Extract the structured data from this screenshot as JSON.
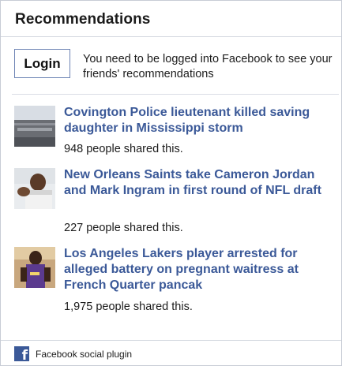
{
  "header": {
    "title": "Recommendations"
  },
  "login": {
    "button_label": "Login",
    "message": "You need to be logged into Facebook to see your friends' recommendations"
  },
  "items": [
    {
      "title": "Covington Police lieutenant killed saving daughter in Mississippi storm",
      "shares": "948 people shared this."
    },
    {
      "title": "New Orleans Saints take Cameron Jordan and Mark Ingram in first round of NFL draft",
      "shares": "227 people shared this."
    },
    {
      "title": "Los Angeles Lakers player arrested for alleged battery on pregnant waitress at French Quarter pancak",
      "shares": "1,975 people shared this."
    }
  ],
  "footer": {
    "label": "Facebook social plugin",
    "icon": "facebook-icon"
  },
  "colors": {
    "link": "#3b5998",
    "border": "#c8ccd6",
    "brand": "#3b5998"
  }
}
